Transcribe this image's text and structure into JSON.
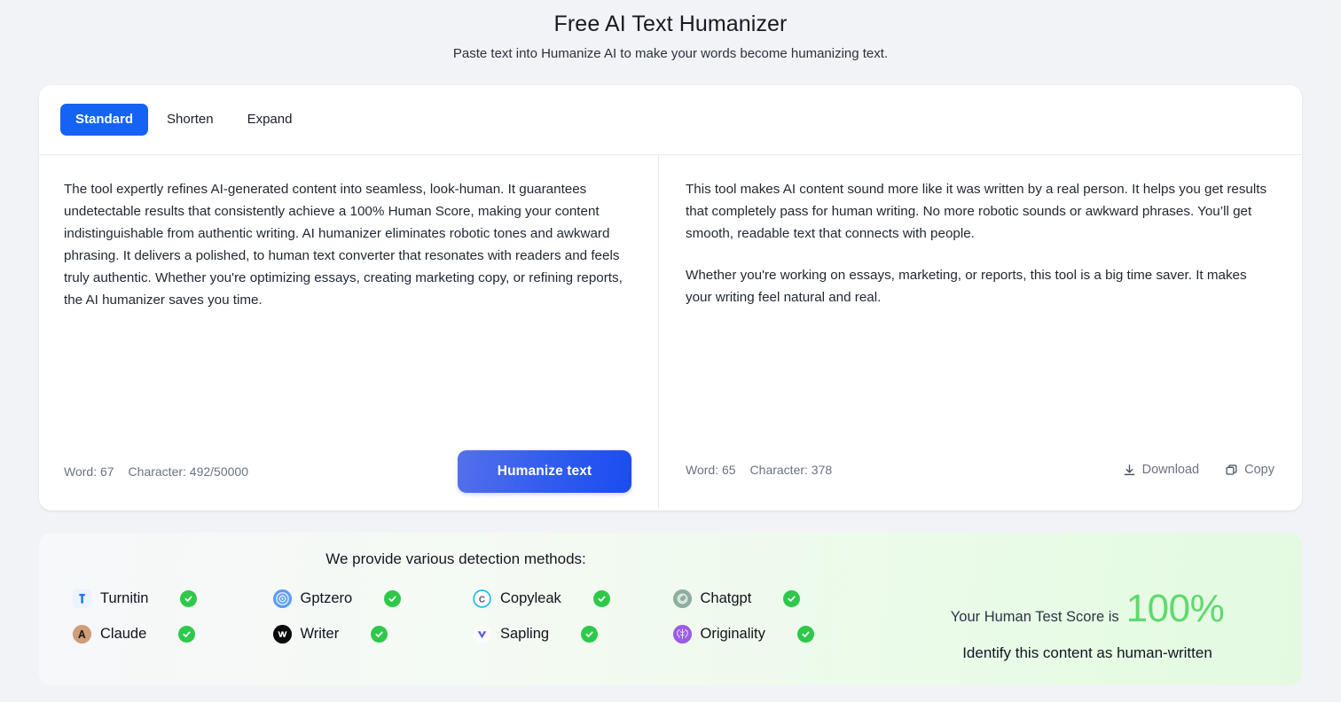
{
  "header": {
    "title": "Free AI Text Humanizer",
    "subtitle": "Paste text into Humanize AI to make your words become humanizing text."
  },
  "tabs": [
    {
      "label": "Standard",
      "active": true
    },
    {
      "label": "Shorten",
      "active": false
    },
    {
      "label": "Expand",
      "active": false
    }
  ],
  "input_panel": {
    "text": "The tool expertly refines AI-generated content into seamless, look-human. It guarantees undetectable results that consistently achieve a 100% Human Score, making your content indistinguishable from authentic writing. AI humanizer eliminates robotic tones and awkward phrasing. It delivers a polished, to human text converter that resonates with readers and feels truly authentic. Whether you're optimizing essays, creating marketing copy, or refining reports, the AI humanizer saves you time.",
    "placeholder": "Paste text into Humanize AI to make your words become humanizing text.",
    "word_count": "Word: 67",
    "character_count": "Character: 492/50000",
    "submit_label": "Humanize text"
  },
  "output_panel": {
    "paragraphs": [
      "This tool makes AI content sound more like it was written by a real person. It helps you get results that completely pass for human writing. No more robotic sounds or awkward phrases. You’ll get smooth, readable text that connects with people.",
      "Whether you're working on essays, marketing, or reports, this tool is a big time saver. It makes your writing feel natural and real."
    ],
    "word_count": "Word: 65",
    "character_count": "Character: 378",
    "download_label": "Download",
    "copy_label": "Copy"
  },
  "detection": {
    "title": "We provide various detection methods:",
    "methods": [
      {
        "name": "Turnitin",
        "icon": "turnitin-logo-icon",
        "checked": true
      },
      {
        "name": "Gptzero",
        "icon": "gptzero-logo-icon",
        "checked": true
      },
      {
        "name": "Copyleak",
        "icon": "copyleak-logo-icon",
        "checked": true
      },
      {
        "name": "Chatgpt",
        "icon": "chatgpt-logo-icon",
        "checked": true
      },
      {
        "name": "Claude",
        "icon": "claude-logo-icon",
        "checked": true
      },
      {
        "name": "Writer",
        "icon": "writer-logo-icon",
        "checked": true
      },
      {
        "name": "Sapling",
        "icon": "sapling-logo-icon",
        "checked": true
      },
      {
        "name": "Originality",
        "icon": "originality-logo-icon",
        "checked": true
      }
    ],
    "score_label": "Your Human Test Score is",
    "score_value": "100%",
    "score_sub": "Identify this content as human-written"
  },
  "colors": {
    "accent_blue": "#1463f3",
    "button_blue": "#2f5bef",
    "check_green": "#2ec84a",
    "score_green": "#5fd96e",
    "page_bg": "#f2f3f7"
  }
}
